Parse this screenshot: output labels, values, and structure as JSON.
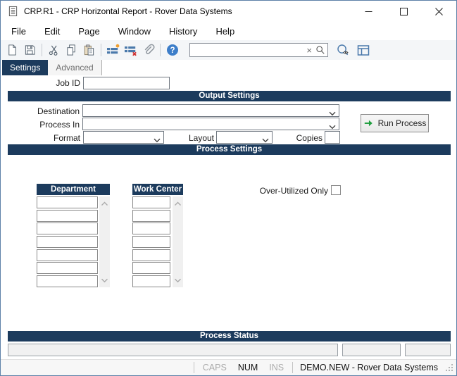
{
  "window": {
    "title": "CRP.R1 - CRP Horizontal Report - Rover Data Systems"
  },
  "menu": {
    "items": [
      "File",
      "Edit",
      "Page",
      "Window",
      "History",
      "Help"
    ]
  },
  "toolbar": {
    "search_value": "",
    "icon_names": [
      "new-document",
      "save",
      "cut",
      "copy",
      "paste",
      "insert-detail",
      "delete-detail",
      "attachment",
      "help",
      "search-clear",
      "search",
      "lookup",
      "grid-layout"
    ]
  },
  "tabs": {
    "settings": "Settings",
    "advanced": "Advanced"
  },
  "job": {
    "label": "Job ID",
    "value": ""
  },
  "output_settings": {
    "title": "Output Settings",
    "destination": {
      "label": "Destination",
      "value": ""
    },
    "process_in": {
      "label": "Process In",
      "value": ""
    },
    "format": {
      "label": "Format",
      "value": ""
    },
    "layout": {
      "label": "Layout",
      "value": ""
    },
    "copies": {
      "label": "Copies",
      "value": ""
    },
    "run_button": "Run Process"
  },
  "process_settings": {
    "title": "Process Settings",
    "department": {
      "header": "Department",
      "rows": 7
    },
    "work_center": {
      "header": "Work Center",
      "rows": 7
    },
    "over_utilized": {
      "label": "Over-Utilized Only",
      "checked": false
    }
  },
  "process_status": {
    "title": "Process Status",
    "fields": [
      "",
      "",
      ""
    ]
  },
  "statusbar": {
    "caps": "CAPS",
    "num": "NUM",
    "ins": "INS",
    "caps_active": false,
    "num_active": true,
    "ins_active": false,
    "session": "DEMO.NEW - Rover Data Systems"
  },
  "icons": {
    "help_glyph": "?",
    "clear_glyph": "×"
  },
  "colors": {
    "navy": "#1c3b5d",
    "icon_blue": "#4a79ab",
    "icon_gray": "#53616e",
    "run_green": "#1e9e3e",
    "alert_orange": "#f0a030",
    "alert_red": "#d03030"
  }
}
